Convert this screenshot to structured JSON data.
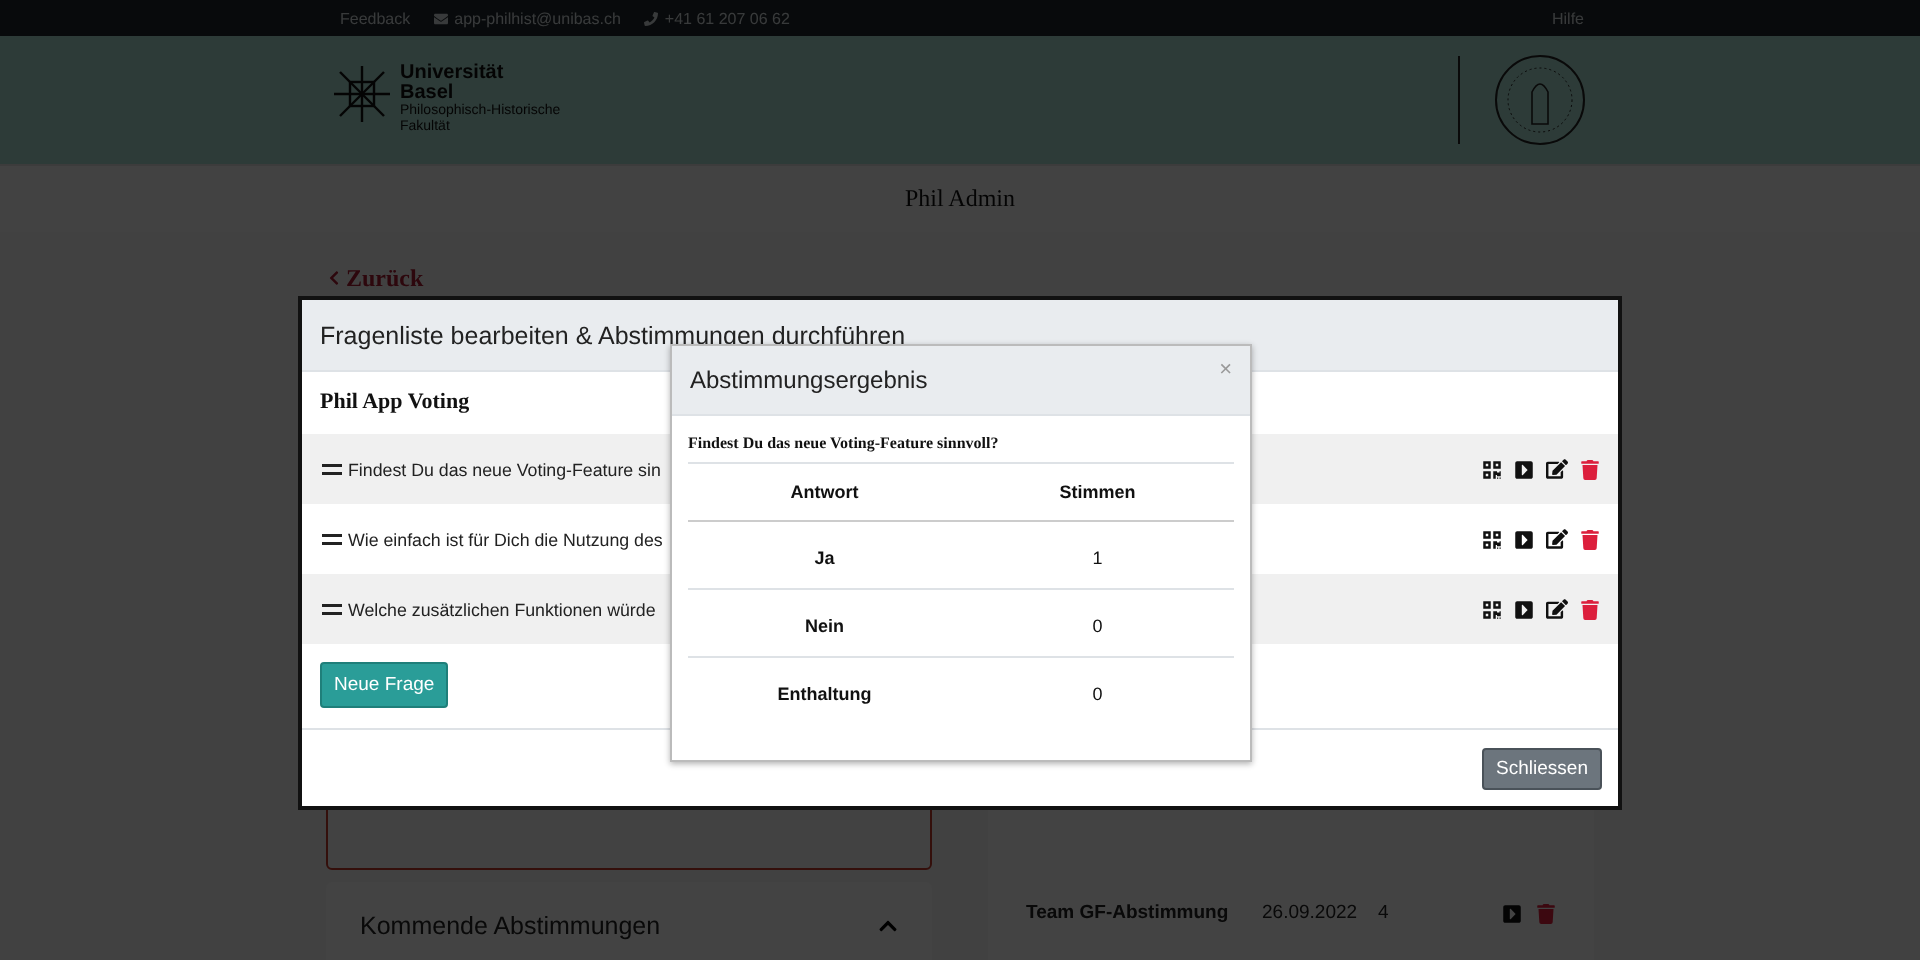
{
  "top_bar": {
    "links": [
      {
        "kind": "text",
        "label": "Feedback"
      },
      {
        "kind": "email",
        "label": "app-philhist@unibas.ch"
      },
      {
        "kind": "phone",
        "label": "+41 61 207 06 62"
      }
    ],
    "help": "Hilfe"
  },
  "header": {
    "logo_lines": [
      "Universität",
      "Basel"
    ],
    "faculty_lines": [
      "Philosophisch-Historische",
      "Fakultät"
    ]
  },
  "title_bar": {
    "title": "Phil Admin"
  },
  "back_link": "Zurück",
  "upcoming_panel": {
    "title": "Kommende Abstimmungen",
    "expanded": true
  },
  "votes_panel": {
    "rows": [
      {
        "name": "Team GF-Abstimmung",
        "date": "26.09.2022",
        "count": "4"
      }
    ]
  },
  "modal": {
    "title": "Fragenliste bearbeiten & Abstimmungen durchführen",
    "list_title": "Phil App Voting",
    "questions": [
      {
        "text": "Findest Du das neue Voting-Feature sin"
      },
      {
        "text": "Wie einfach ist für Dich die Nutzung des"
      },
      {
        "text": "Welche zusätzlichen Funktionen würde"
      }
    ],
    "new_button": "Neue Frage",
    "close_button": "Schliessen"
  },
  "result_dialog": {
    "title": "Abstimmungsergebnis",
    "close": "×",
    "question": "Findest Du das neue Voting-Feature sinnvoll?",
    "columns": [
      "Antwort",
      "Stimmen"
    ],
    "rows": [
      {
        "answer": "Ja",
        "votes": "1"
      },
      {
        "answer": "Nein",
        "votes": "0"
      },
      {
        "answer": "Enthaltung",
        "votes": "0"
      }
    ]
  }
}
